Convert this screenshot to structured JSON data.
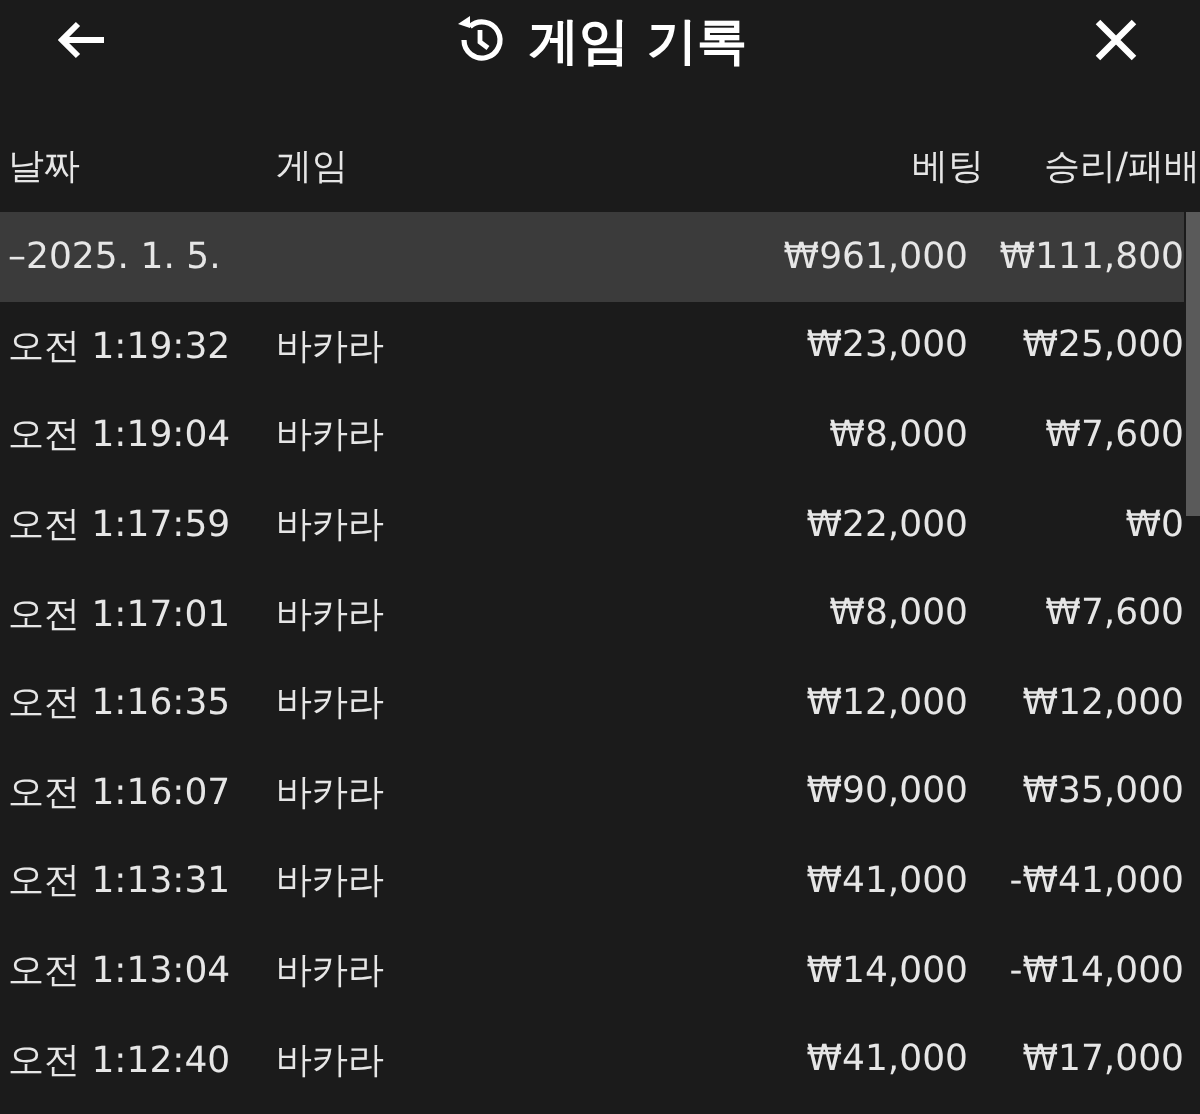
{
  "header": {
    "title": "게임 기록"
  },
  "table": {
    "columns": [
      "날짜",
      "게임",
      "베팅",
      "승리/패배"
    ],
    "group": {
      "date": "–2025. 1. 5.",
      "bet": "₩961,000",
      "result": "₩111,800"
    },
    "rows": [
      {
        "time": "오전 1:19:32",
        "game": "바카라",
        "bet": "₩23,000",
        "result": "₩25,000"
      },
      {
        "time": "오전 1:19:04",
        "game": "바카라",
        "bet": "₩8,000",
        "result": "₩7,600"
      },
      {
        "time": "오전 1:17:59",
        "game": "바카라",
        "bet": "₩22,000",
        "result": "₩0"
      },
      {
        "time": "오전 1:17:01",
        "game": "바카라",
        "bet": "₩8,000",
        "result": "₩7,600"
      },
      {
        "time": "오전 1:16:35",
        "game": "바카라",
        "bet": "₩12,000",
        "result": "₩12,000"
      },
      {
        "time": "오전 1:16:07",
        "game": "바카라",
        "bet": "₩90,000",
        "result": "₩35,000"
      },
      {
        "time": "오전 1:13:31",
        "game": "바카라",
        "bet": "₩41,000",
        "result": "-₩41,000"
      },
      {
        "time": "오전 1:13:04",
        "game": "바카라",
        "bet": "₩14,000",
        "result": "-₩14,000"
      },
      {
        "time": "오전 1:12:40",
        "game": "바카라",
        "bet": "₩41,000",
        "result": "₩17,000"
      }
    ]
  }
}
